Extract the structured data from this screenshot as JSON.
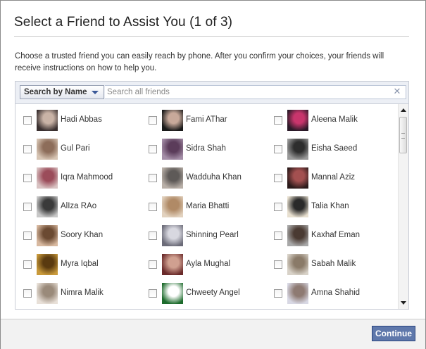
{
  "dialog": {
    "title": "Select a Friend to Assist You (1 of 3)",
    "description": "Choose a trusted friend you can easily reach by phone. After you confirm your choices, your friends will receive instructions on how to help you."
  },
  "search": {
    "mode_label": "Search by Name",
    "placeholder": "Search all friends",
    "value": "",
    "clear_glyph": "✕"
  },
  "friends": [
    {
      "name": "Hadi Abbas",
      "avatar_colors": [
        "#3a3030",
        "#c9b3a6"
      ]
    },
    {
      "name": "Fami AThar",
      "avatar_colors": [
        "#1a1a1a",
        "#c8a99a"
      ]
    },
    {
      "name": "Aleena Malik",
      "avatar_colors": [
        "#2a1a28",
        "#c8356c"
      ]
    },
    {
      "name": "Gul Pari",
      "avatar_colors": [
        "#d7c5b4",
        "#8d6d5a"
      ]
    },
    {
      "name": "Sidra Shah",
      "avatar_colors": [
        "#a58fa8",
        "#5b3c5a"
      ]
    },
    {
      "name": "Eisha Saeed",
      "avatar_colors": [
        "#9a9a9a",
        "#2e2e2e"
      ]
    },
    {
      "name": "Iqra Mahmood",
      "avatar_colors": [
        "#d9c3c3",
        "#9b4c5a"
      ]
    },
    {
      "name": "Wadduha Khan",
      "avatar_colors": [
        "#b9b0a8",
        "#5e5a58"
      ]
    },
    {
      "name": "Mannal Aziz",
      "avatar_colors": [
        "#2b1a1a",
        "#a35050"
      ]
    },
    {
      "name": "AlIza RAo",
      "avatar_colors": [
        "#c8c8c8",
        "#3a3a3a"
      ]
    },
    {
      "name": "Maria Bhatti",
      "avatar_colors": [
        "#e2d2bf",
        "#b08a66"
      ]
    },
    {
      "name": "Talia Khan",
      "avatar_colors": [
        "#e8e0d0",
        "#2a2a2a"
      ]
    },
    {
      "name": "Soory Khan",
      "avatar_colors": [
        "#d8b9a0",
        "#6b4a32"
      ]
    },
    {
      "name": "Shinning Pearl",
      "avatar_colors": [
        "#6b6b78",
        "#d8d8e0"
      ]
    },
    {
      "name": "Kaxhaf Eman",
      "avatar_colors": [
        "#a8a8a8",
        "#4a3a32"
      ]
    },
    {
      "name": "Myra Iqbal",
      "avatar_colors": [
        "#c99a3b",
        "#5a3a10"
      ]
    },
    {
      "name": "Ayla Mughal",
      "avatar_colors": [
        "#6a2a2a",
        "#d0a090"
      ]
    },
    {
      "name": "Sabah Malik",
      "avatar_colors": [
        "#d8d2c8",
        "#8a7a68"
      ]
    },
    {
      "name": "Nimra Malik",
      "avatar_colors": [
        "#e8e0d8",
        "#9a8a7a"
      ]
    },
    {
      "name": "Chweety Angel",
      "avatar_colors": [
        "#1d6b2c",
        "#ffffff"
      ]
    },
    {
      "name": "Amna Shahid",
      "avatar_colors": [
        "#d8d8e4",
        "#8e7a72"
      ]
    }
  ],
  "footer": {
    "continue_label": "Continue"
  },
  "colors": {
    "brand": "#3b5998",
    "button_bg": "#5f78ab",
    "search_bar_bg": "#eceff5"
  }
}
